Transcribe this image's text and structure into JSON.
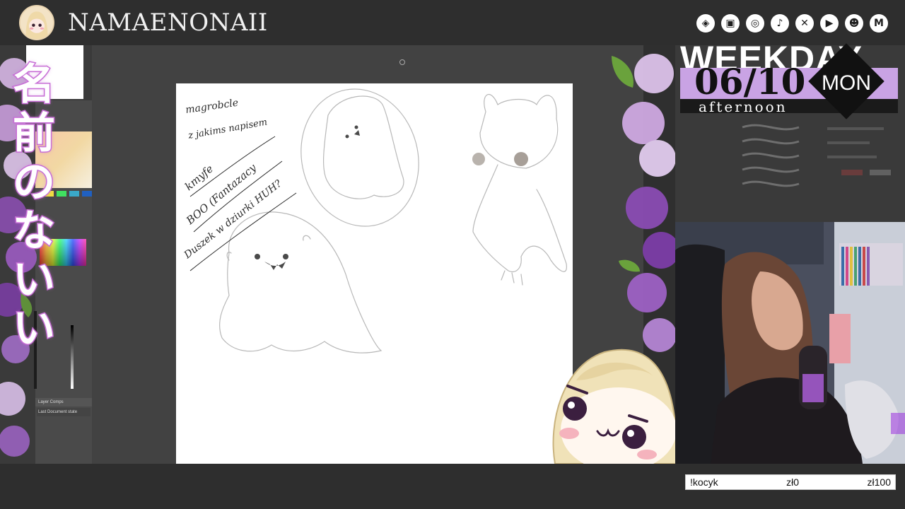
{
  "header": {
    "channel_name": "NAMAENONAII",
    "social_icons": [
      "streamlabs-icon",
      "twitch-icon",
      "instagram-icon",
      "tiktok-icon",
      "x-icon",
      "youtube-icon",
      "discord-icon",
      "gmail-icon"
    ]
  },
  "sidebar": {
    "japanese_title": "名前のないい",
    "layer_comps_label": "Layer Comps",
    "layer_comps_state": "Last Document state"
  },
  "canvas": {
    "note_lines": [
      "magrobcle",
      "z jakims napisem",
      "kmyfe",
      "BOO (Fantazacy",
      "Duszek w dziurki HUH?"
    ]
  },
  "schedule": {
    "weekday_label": "WEEKDAY",
    "date": "06/10",
    "day": "MON",
    "time_of_day": "afternoon",
    "accent_color": "#c9a3e4"
  },
  "donation_goal": {
    "command": "!kocyk",
    "current": "zł0",
    "target": "zł100"
  },
  "colors": {
    "background": "#2e2e2e",
    "canvas": "#ffffff",
    "lilac": "#b07ad0"
  }
}
